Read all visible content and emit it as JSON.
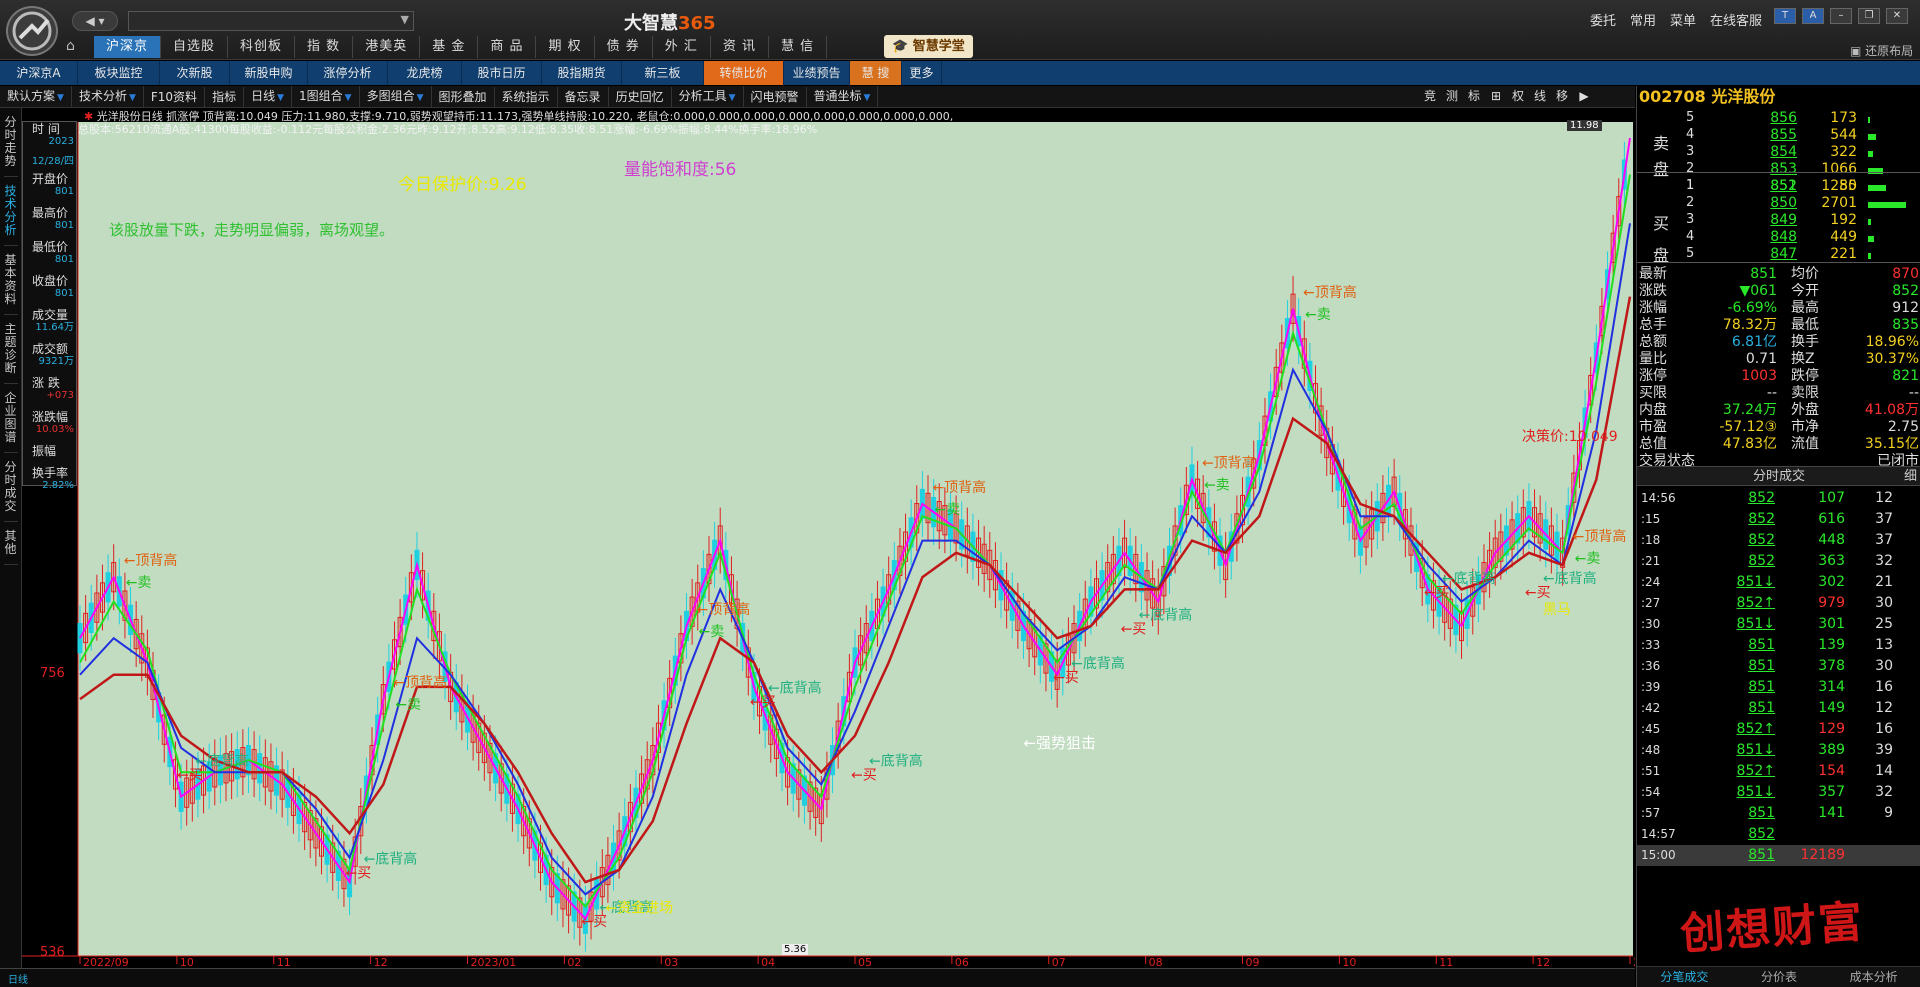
{
  "app": {
    "title_prefix": "大智慧",
    "title_suffix": "365",
    "top_right": [
      "委托",
      "常用",
      "菜单",
      "在线客服"
    ],
    "nav_back": "◀ ▾",
    "academy": "智慧学堂",
    "restore_layout": "还原布局",
    "nav_tabs": [
      "沪深京",
      "自选股",
      "科创板",
      "指 数",
      "港美英",
      "基 金",
      "商 品",
      "期 权",
      "债 券",
      "外 汇",
      "资 讯",
      "慧 信"
    ]
  },
  "subtabs": [
    "沪深京A",
    "板块监控",
    "次新股",
    "新股申购",
    "涨停分析",
    "龙虎榜",
    "股市日历",
    "股指期货",
    "新三板",
    "转债比价",
    "业绩预告",
    "慧 搜",
    "更多"
  ],
  "toolbar": [
    "默认方案",
    "技术分析",
    "F10资料",
    "指标",
    "日线",
    "1图组合",
    "多图组合",
    "图形叠加",
    "系统指示",
    "备忘录",
    "历史回忆",
    "分析工具",
    "闪电预警",
    "普通坐标"
  ],
  "right_tools": [
    "竞",
    "测",
    "标",
    "⊞",
    "权",
    "线",
    "移",
    "▶"
  ],
  "vtabs": [
    "分时走势",
    "技术分析",
    "基本资料",
    "主题诊断",
    "企业图谱",
    "分时成交",
    "其他"
  ],
  "ohlc": {
    "rows": [
      {
        "label": "时 间",
        "value": "2023"
      },
      {
        "label": "",
        "value": "12/28/四"
      },
      {
        "label": "开盘价",
        "value": "801"
      },
      {
        "label": "最高价",
        "value": "801"
      },
      {
        "label": "最低价",
        "value": "801"
      },
      {
        "label": "收盘价",
        "value": "801"
      },
      {
        "label": "成交量",
        "value": "11.64万"
      },
      {
        "label": "成交额",
        "value": "9321万"
      },
      {
        "label": "涨 跌",
        "value": "+073"
      },
      {
        "label": "涨跌幅",
        "value": "10.03%"
      },
      {
        "label": "振幅",
        "value": ""
      },
      {
        "label": "换手率",
        "value": "2.82%"
      }
    ]
  },
  "chart_header": {
    "line1": "光洋股份日线  抓涨停  顶背离:10.049  压力:11.980,支撑:9.710,弱势观望持币:11.173,强势单线持股:10.220, 老鼠仓:0.000,0.000,0.000,0.000,0.000,0.000,0.000,0.000,",
    "line2": "总股本:56210流通A股:41300每股收益:-0.112元每股公积金:2.36元昨:9.12开:8.52高:9.12低:8.35收:8.51涨幅:-6.69%振幅:8.44%换手率:18.96%",
    "protect_price": "今日保护价:9.26",
    "saturation_label": "量能饱和度:",
    "saturation_value": "56",
    "advice": "该股放量下跌，走势明显偏弱，离场观望。",
    "decision_price": "决策价:10.049",
    "y_top": "11.98",
    "y_mid": "756",
    "y_bottom": "536",
    "bottom_low": "5.36",
    "period_label": "日线"
  },
  "chart_data": {
    "type": "line",
    "x_labels": [
      "2022/09",
      "10",
      "11",
      "12",
      "2023/01",
      "02",
      "03",
      "04",
      "05",
      "06",
      "07",
      "08",
      "09",
      "10",
      "11",
      "12",
      "2024/01"
    ],
    "ylim": [
      5.36,
      12.0
    ],
    "series": [
      {
        "name": "",
        "color": "#ff00ff",
        "values": [
          7.9,
          8.4,
          7.7,
          6.6,
          6.8,
          6.9,
          6.7,
          6.3,
          5.9,
          7.4,
          8.5,
          7.5,
          7.0,
          6.5,
          5.9,
          5.6,
          6.2,
          6.9,
          8.0,
          8.7,
          7.5,
          6.8,
          6.5,
          7.7,
          8.3,
          9.0,
          8.8,
          8.5,
          8.0,
          7.6,
          8.2,
          8.6,
          8.2,
          9.2,
          8.5,
          9.4,
          10.6,
          9.5,
          8.7,
          9.1,
          8.3,
          8.0,
          8.6,
          8.9,
          8.6,
          10.2,
          12.0
        ]
      },
      {
        "name": "",
        "color": "#20e020",
        "values": [
          7.7,
          8.2,
          7.8,
          6.8,
          6.8,
          6.9,
          6.8,
          6.4,
          6.0,
          7.2,
          8.3,
          7.6,
          7.1,
          6.6,
          6.0,
          5.7,
          6.1,
          6.8,
          7.9,
          8.6,
          7.6,
          6.9,
          6.6,
          7.5,
          8.2,
          8.9,
          8.8,
          8.5,
          8.1,
          7.7,
          8.1,
          8.5,
          8.3,
          9.1,
          8.6,
          9.3,
          10.4,
          9.6,
          8.8,
          9.0,
          8.4,
          8.1,
          8.5,
          8.8,
          8.6,
          10.0,
          11.7
        ]
      },
      {
        "name": "",
        "color": "#2030e0",
        "values": [
          7.6,
          7.9,
          7.7,
          7.0,
          6.8,
          6.8,
          6.8,
          6.5,
          6.1,
          6.9,
          7.9,
          7.6,
          7.2,
          6.7,
          6.1,
          5.8,
          6.0,
          6.6,
          7.6,
          8.3,
          7.7,
          7.0,
          6.7,
          7.3,
          8.0,
          8.7,
          8.7,
          8.5,
          8.1,
          7.8,
          8.0,
          8.4,
          8.3,
          8.9,
          8.6,
          9.1,
          10.1,
          9.6,
          8.9,
          8.9,
          8.5,
          8.2,
          8.4,
          8.7,
          8.5,
          9.6,
          11.3
        ]
      },
      {
        "name": "",
        "color": "#c01818",
        "values": [
          7.4,
          7.6,
          7.6,
          7.1,
          6.9,
          6.8,
          6.8,
          6.6,
          6.3,
          6.7,
          7.5,
          7.5,
          7.2,
          6.8,
          6.3,
          5.9,
          6.0,
          6.4,
          7.2,
          7.9,
          7.7,
          7.1,
          6.8,
          7.1,
          7.7,
          8.4,
          8.6,
          8.5,
          8.2,
          7.9,
          8.0,
          8.3,
          8.3,
          8.7,
          8.6,
          8.9,
          9.7,
          9.5,
          9.0,
          8.9,
          8.6,
          8.3,
          8.4,
          8.6,
          8.5,
          9.2,
          10.7
        ]
      }
    ]
  },
  "annotations": {
    "top_peaks": [
      "顶背高",
      "顶背高",
      "顶背高",
      "顶背高",
      "顶背高",
      "顶背高",
      "顶背高",
      "顶背高",
      "顶背高",
      "顶背高"
    ],
    "bottoms": [
      "底背高",
      "底背高",
      "底背高",
      "底背高",
      "底背高",
      "底背高",
      "底背高",
      "底背高",
      "底背高"
    ],
    "buy": "买",
    "sell": "卖",
    "sniper": "强势狙击",
    "capital": "资金进场",
    "dark_horse": "黑马"
  },
  "right_panel": {
    "stock": "002708 光洋股份",
    "sell_label": [
      "卖",
      "盘"
    ],
    "buy_label": [
      "买",
      "盘"
    ],
    "asks": [
      {
        "lv": "5",
        "price": "856",
        "vol": "173"
      },
      {
        "lv": "4",
        "price": "855",
        "vol": "544"
      },
      {
        "lv": "3",
        "price": "854",
        "vol": "322"
      },
      {
        "lv": "2",
        "price": "853",
        "vol": "1066"
      },
      {
        "lv": "1",
        "price": "852",
        "vol": "1285"
      }
    ],
    "bids": [
      {
        "lv": "1",
        "price": "851",
        "vol": "50"
      },
      {
        "lv": "2",
        "price": "850",
        "vol": "2701"
      },
      {
        "lv": "3",
        "price": "849",
        "vol": "192"
      },
      {
        "lv": "4",
        "price": "848",
        "vol": "449"
      },
      {
        "lv": "5",
        "price": "847",
        "vol": "221"
      }
    ],
    "quotes": [
      {
        "k1": "最新",
        "v1": "851",
        "c1": "g",
        "k2": "均价",
        "v2": "870",
        "c2": "r"
      },
      {
        "k1": "涨跌",
        "v1": "▼061",
        "c1": "g",
        "k2": "今开",
        "v2": "852",
        "c2": "g"
      },
      {
        "k1": "涨幅",
        "v1": "-6.69%",
        "c1": "g",
        "k2": "最高",
        "v2": "912",
        "c2": "w"
      },
      {
        "k1": "总手",
        "v1": "78.32万",
        "c1": "y",
        "k2": "最低",
        "v2": "835",
        "c2": "g"
      },
      {
        "k1": "总额",
        "v1": "6.81亿",
        "c1": "c",
        "k2": "换手",
        "v2": "18.96%",
        "c2": "y"
      },
      {
        "k1": "量比",
        "v1": "0.71",
        "c1": "w",
        "k2": "换Z",
        "v2": "30.37%",
        "c2": "y"
      },
      {
        "k1": "涨停",
        "v1": "1003",
        "c1": "r",
        "k2": "跌停",
        "v2": "821",
        "c2": "g"
      },
      {
        "k1": "买限",
        "v1": "--",
        "c1": "w",
        "k2": "卖限",
        "v2": "--",
        "c2": "w"
      },
      {
        "k1": "内盘",
        "v1": "37.24万",
        "c1": "g",
        "k2": "外盘",
        "v2": "41.08万",
        "c2": "r"
      },
      {
        "k1": "市盈",
        "v1": "-57.12③",
        "c1": "y",
        "k2": "市净",
        "v2": "2.75",
        "c2": "w"
      },
      {
        "k1": "总值",
        "v1": "47.83亿",
        "c1": "y",
        "k2": "流值",
        "v2": "35.15亿",
        "c2": "y"
      },
      {
        "k1": "交易状态",
        "v1": "",
        "c1": "w",
        "k2": "",
        "v2": "已闭市",
        "c2": "w"
      }
    ],
    "trades_title": "分时成交",
    "trades_tab": "细",
    "trades": [
      {
        "t": "14:56",
        "p": "852",
        "v": "107",
        "vc": "g",
        "n": "12"
      },
      {
        "t": ":15",
        "p": "852",
        "v": "616",
        "vc": "g",
        "n": "37"
      },
      {
        "t": ":18",
        "p": "852",
        "v": "448",
        "vc": "g",
        "n": "37"
      },
      {
        "t": ":21",
        "p": "852",
        "v": "363",
        "vc": "g",
        "n": "32"
      },
      {
        "t": ":24",
        "p": "851↓",
        "v": "302",
        "vc": "g",
        "n": "21"
      },
      {
        "t": ":27",
        "p": "852↑",
        "v": "979",
        "vc": "r",
        "n": "30"
      },
      {
        "t": ":30",
        "p": "851↓",
        "v": "301",
        "vc": "g",
        "n": "25"
      },
      {
        "t": ":33",
        "p": "851",
        "v": "139",
        "vc": "g",
        "n": "13"
      },
      {
        "t": ":36",
        "p": "851",
        "v": "378",
        "vc": "g",
        "n": "30"
      },
      {
        "t": ":39",
        "p": "851",
        "v": "314",
        "vc": "g",
        "n": "16"
      },
      {
        "t": ":42",
        "p": "851",
        "v": "149",
        "vc": "g",
        "n": "12"
      },
      {
        "t": ":45",
        "p": "852↑",
        "v": "129",
        "vc": "r",
        "n": "16"
      },
      {
        "t": ":48",
        "p": "851↓",
        "v": "389",
        "vc": "g",
        "n": "39"
      },
      {
        "t": ":51",
        "p": "852↑",
        "v": "154",
        "vc": "r",
        "n": "14"
      },
      {
        "t": ":54",
        "p": "851↓",
        "v": "357",
        "vc": "g",
        "n": "32"
      },
      {
        "t": ":57",
        "p": "851",
        "v": "141",
        "vc": "g",
        "n": "9"
      },
      {
        "t": "14:57",
        "p": "852",
        "v": "",
        "vc": "g",
        "n": ""
      },
      {
        "t": "15:00",
        "p": "851",
        "v": "12189",
        "vc": "r",
        "n": ""
      }
    ],
    "bottom_tabs": [
      "分笔成交",
      "分价表",
      "成本分析"
    ]
  },
  "watermark": "创想财富"
}
